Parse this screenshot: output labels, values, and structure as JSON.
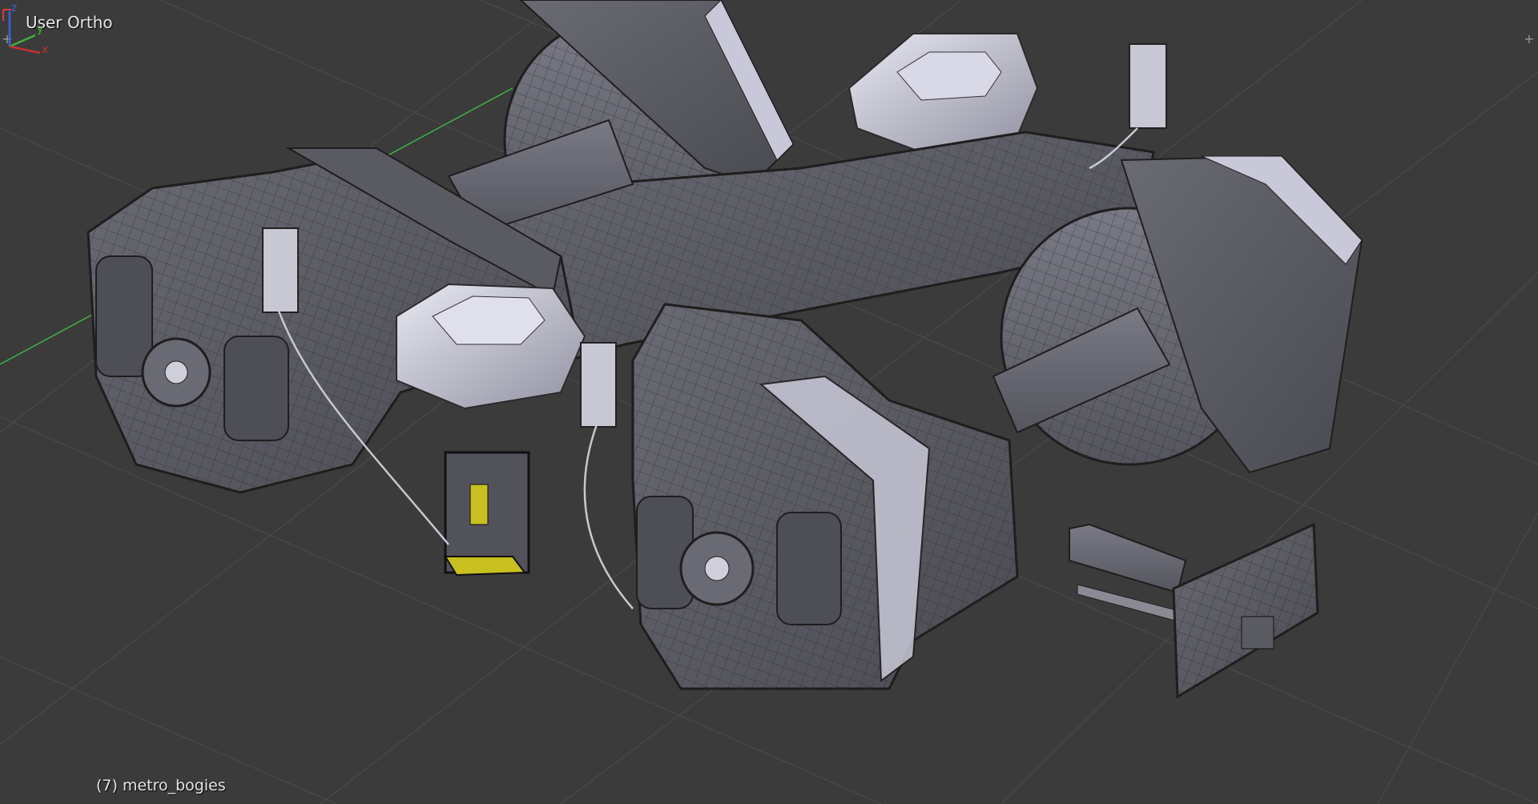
{
  "viewport": {
    "view_label": "User Ortho",
    "object_label": "(7) metro_bogies"
  },
  "gizmo": {
    "x_label": "x",
    "y_label": "y",
    "z_label": "z"
  },
  "icons": {
    "corner_left": "plus-split-icon",
    "corner_right": "plus-split-icon"
  },
  "colors": {
    "background": "#3b3b3b",
    "grid": "#4a4a4a",
    "axis_green": "#3fb03f",
    "axis_red": "#c83030",
    "selected_yellow": "#c8c020",
    "mesh_dark": "#5e5e66",
    "mesh_light": "#b8b8c8"
  }
}
